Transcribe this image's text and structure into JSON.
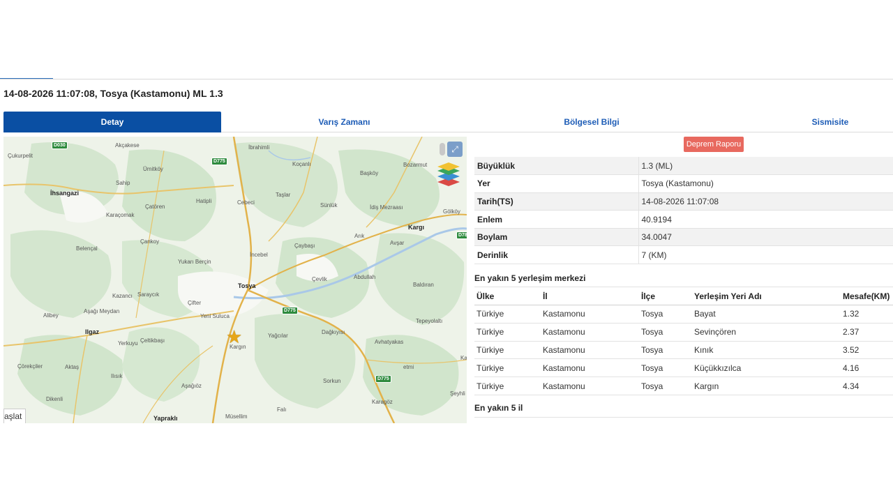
{
  "page": {
    "title": "14-08-2026 11:07:08, Tosya (Kastamonu) ML 1.3"
  },
  "tabs": [
    {
      "label": "Detay",
      "active": true
    },
    {
      "label": "Varış Zamanı",
      "active": false
    },
    {
      "label": "Bölgesel Bilgi",
      "active": false
    },
    {
      "label": "Sismisite",
      "active": false
    }
  ],
  "map": {
    "labels": {
      "cukurpelit": "Çukurpelit",
      "akcakese": "Akçakese",
      "umitkoy": "Ümitköy",
      "sahip": "Sahip",
      "ihsangazi": "İhsangazi",
      "catoren": "Çatören",
      "karacomak": "Karaçomak",
      "ankoy": "Çankoy",
      "belencal": "Belençal",
      "yukanbercin": "Yukarı Berçin",
      "kazanci": "Kazancı",
      "saraycik": "Saraycık",
      "asagimeydan": "Aşağı Meydan",
      "alibey": "Alibey",
      "ilgaz": "Ilgaz",
      "yerkuyu": "Yerkuyu",
      "celtikbasi": "Çeltikbaşı",
      "corekciler": "Çörekçiler",
      "aktas": "Aktaş",
      "ilisik": "Ilısık",
      "dikenli": "Dikenli",
      "asagioz": "Aşağıöz",
      "yaprakli": "Yapraklı",
      "musellim": "Müsellim",
      "fali": "Falı",
      "ibrahimli": "İbrahimli",
      "kocanli": "Koçanlı",
      "hatipli": "Hatipli",
      "cebeci": "Cebeci",
      "taslar": "Taşlar",
      "sunluk": "Sünlük",
      "incebel": "İncebel",
      "caybasi": "Çaybaşı",
      "tosya": "Tosya",
      "cifter": "Çifter",
      "yenisuluca": "Yeni Suluca",
      "kargin": "Kargın",
      "yagcilar": "Yağcılar",
      "dagkuyusu": "Dağkıyısı",
      "cevlik": "Çevlik",
      "abdullah": "Abdullah",
      "avhatyakas": "Avhatyakas",
      "sorkun": "Sorkun",
      "karagoz": "Karagöz",
      "bozarmut": "Bozarmut",
      "baskoy": "Başköy",
      "idismezraasi": "İdiş Mezraası",
      "golkoy": "Gölköy",
      "kargi": "Kargı",
      "arik": "Arık",
      "avsar": "Avşar",
      "baldiran": "Baldıran",
      "tepeyolalti": "Tepeyolaltı",
      "etmi": "etmi",
      "seyhli": "Şeyhli",
      "ka": "Ka"
    },
    "roads": {
      "d030": "D030",
      "d775a": "D775",
      "d775b": "D775",
      "d775c": "D775",
      "d78": "D78"
    },
    "corner_button": "Başlat"
  },
  "report_button": "Deprem Raporu",
  "details": [
    {
      "key": "Büyüklük",
      "value": "1.3 (ML)"
    },
    {
      "key": "Yer",
      "value": "Tosya (Kastamonu)"
    },
    {
      "key": "Tarih(TS)",
      "value": "14-08-2026 11:07:08"
    },
    {
      "key": "Enlem",
      "value": "40.9194"
    },
    {
      "key": "Boylam",
      "value": "34.0047"
    },
    {
      "key": "Derinlik",
      "value": "7 (KM)"
    }
  ],
  "nearest_settlements": {
    "heading": "En yakın 5 yerleşim merkezi",
    "columns": [
      "Ülke",
      "İl",
      "İlçe",
      "Yerleşim Yeri Adı",
      "Mesafe(KM)"
    ],
    "rows": [
      [
        "Türkiye",
        "Kastamonu",
        "Tosya",
        "Bayat",
        "1.32"
      ],
      [
        "Türkiye",
        "Kastamonu",
        "Tosya",
        "Sevinçören",
        "2.37"
      ],
      [
        "Türkiye",
        "Kastamonu",
        "Tosya",
        "Kınık",
        "3.52"
      ],
      [
        "Türkiye",
        "Kastamonu",
        "Tosya",
        "Küçükkızılca",
        "4.16"
      ],
      [
        "Türkiye",
        "Kastamonu",
        "Tosya",
        "Kargın",
        "4.34"
      ]
    ]
  },
  "nearest_provinces": {
    "heading": "En yakın 5 il"
  },
  "colors": {
    "tab_active": "#0a4fa3",
    "tab_text": "#1d5cb6",
    "report_button": "#e8695f",
    "epicenter_star": "#e6a619"
  }
}
